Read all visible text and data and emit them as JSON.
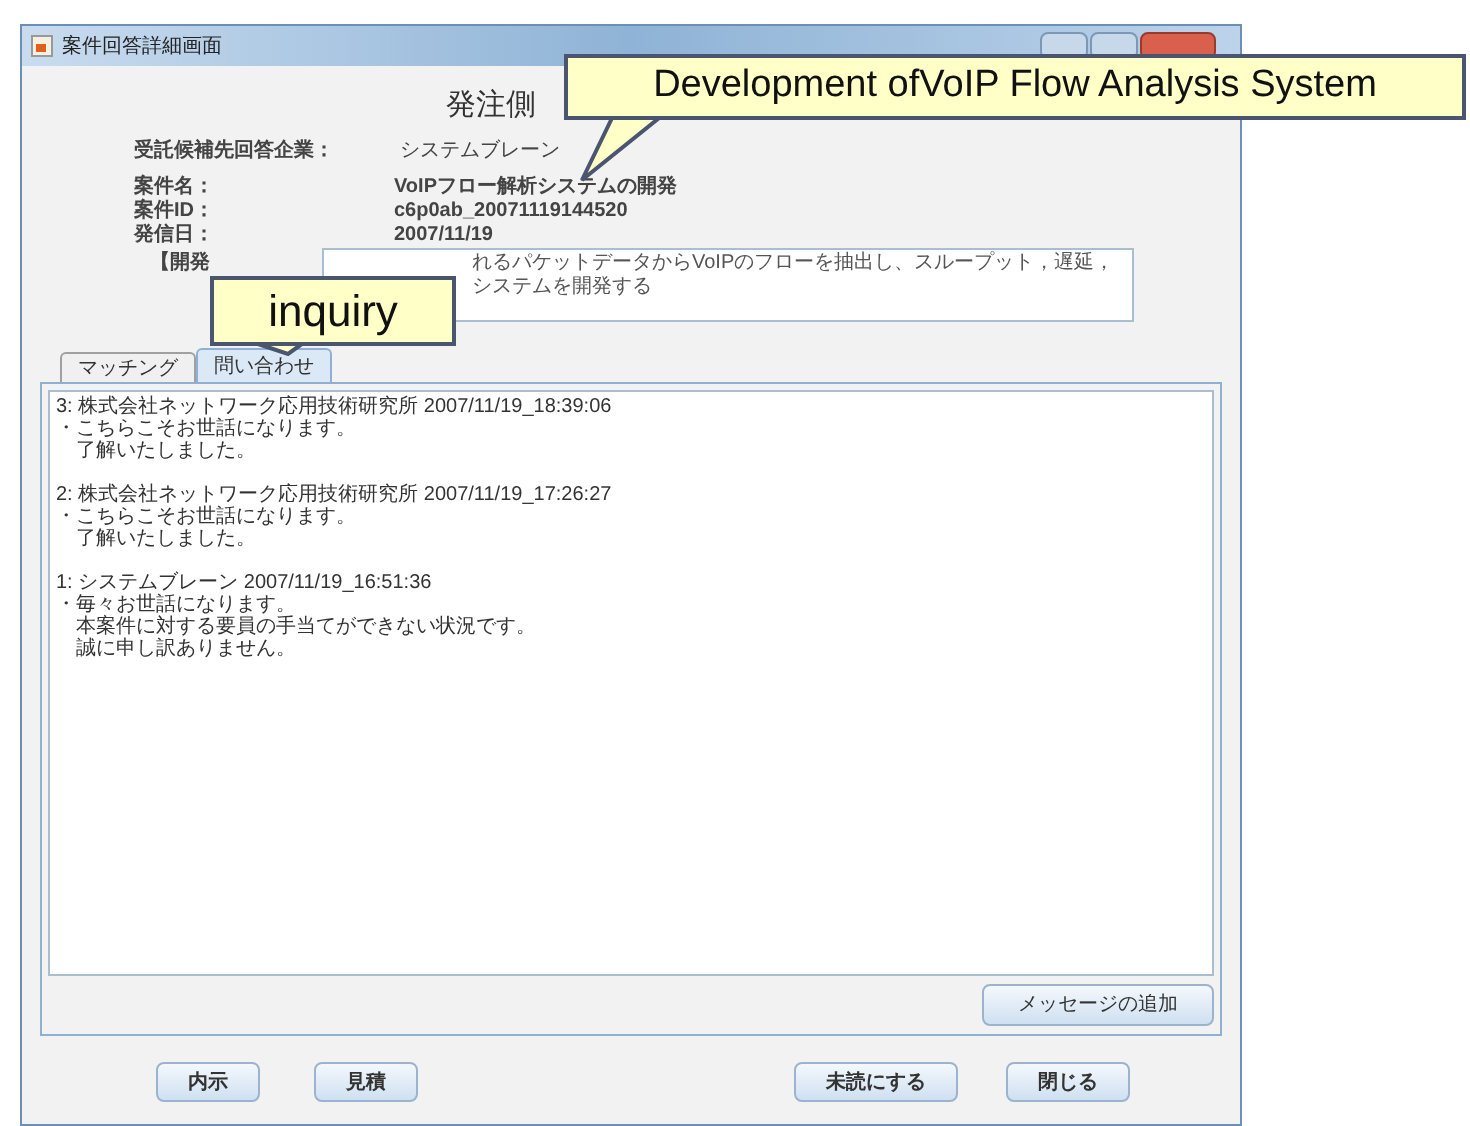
{
  "window": {
    "title": "案件回答詳細画面"
  },
  "heading": "発注側",
  "fields": [
    {
      "label": "受託候補先回答企業：",
      "value": "システムブレーン",
      "kind": "company"
    },
    {
      "label": "案件名：",
      "value": "VoIPフロー解析システムの開発",
      "kind": "info"
    },
    {
      "label": "案件ID：",
      "value": "c6p0ab_20071119144520",
      "kind": "info"
    },
    {
      "label": "発信日：",
      "value": "2007/11/19",
      "kind": "info"
    }
  ],
  "description": {
    "label": "【開発",
    "lines": [
      "れるパケットデータからVoIPのフローを抽出し、スループット，遅延，",
      "システムを開発する"
    ]
  },
  "tabs": [
    {
      "label": "マッチング",
      "selected": false
    },
    {
      "label": "問い合わせ",
      "selected": true
    }
  ],
  "messages": [
    {
      "header": "3: 株式会社ネットワーク応用技術研究所 2007/11/19_18:39:06",
      "lines": [
        "・こちらこそお世話になります。",
        "　了解いたしました。"
      ]
    },
    {
      "header": "2: 株式会社ネットワーク応用技術研究所 2007/11/19_17:26:27",
      "lines": [
        "・こちらこそお世話になります。",
        "　了解いたしました。"
      ]
    },
    {
      "header": "1: システムブレーン 2007/11/19_16:51:36",
      "lines": [
        "・毎々お世話になります。",
        "　本案件に対する要員の手当てができない状況です。",
        "　誠に申し訳ありません。"
      ]
    }
  ],
  "add_message_button": "メッセージの追加",
  "buttons": [
    "内示",
    "見積",
    "未読にする",
    "閉じる"
  ],
  "callouts": [
    {
      "text": "Development ofVoIP Flow Analysis System",
      "kind": "wide"
    },
    {
      "text": "inquiry",
      "kind": "small"
    }
  ]
}
